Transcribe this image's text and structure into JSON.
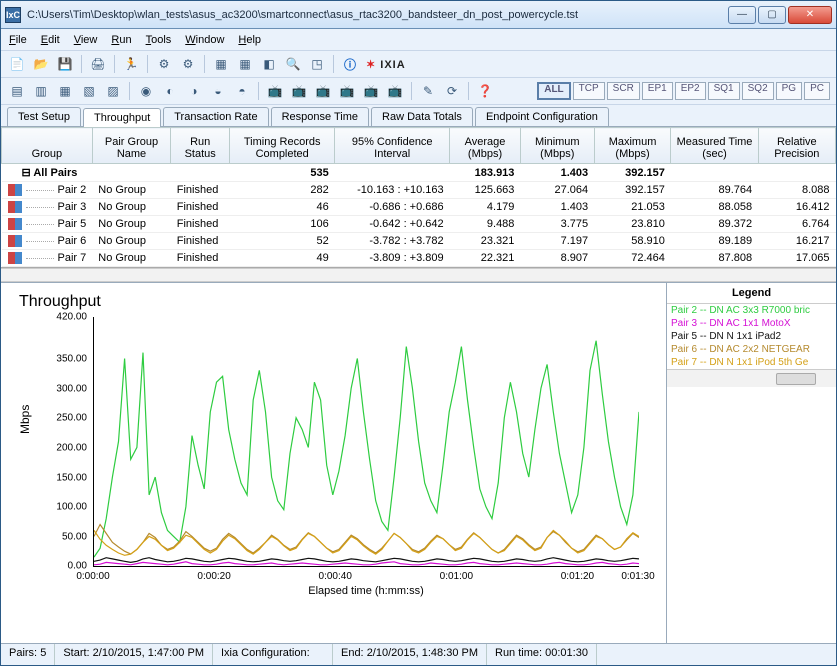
{
  "window": {
    "title": "C:\\Users\\Tim\\Desktop\\wlan_tests\\asus_ac3200\\smartconnect\\asus_rtac3200_bandsteer_dn_post_powercycle.tst",
    "app_icon_text": "IxC"
  },
  "menu": {
    "file": "File",
    "edit": "Edit",
    "view": "View",
    "run": "Run",
    "tools": "Tools",
    "window": "Window",
    "help": "Help"
  },
  "brand": "IXIA",
  "filters": [
    "ALL",
    "TCP",
    "SCR",
    "EP1",
    "EP2",
    "SQ1",
    "SQ2",
    "PG",
    "PC"
  ],
  "tabs": [
    "Test Setup",
    "Throughput",
    "Transaction Rate",
    "Response Time",
    "Raw Data Totals",
    "Endpoint Configuration"
  ],
  "active_tab": "Throughput",
  "grid": {
    "headers": [
      "Group",
      "Pair Group Name",
      "Run Status",
      "Timing Records Completed",
      "95% Confidence Interval",
      "Average (Mbps)",
      "Minimum (Mbps)",
      "Maximum (Mbps)",
      "Measured Time (sec)",
      "Relative Precision"
    ],
    "allpairs": {
      "label": "All Pairs",
      "trc": "535",
      "avg": "183.913",
      "min": "1.403",
      "max": "392.157"
    },
    "rows": [
      {
        "name": "Pair 2",
        "pg": "No Group",
        "rs": "Finished",
        "trc": "282",
        "ci": "-10.163 : +10.163",
        "avg": "125.663",
        "min": "27.064",
        "max": "392.157",
        "mt": "89.764",
        "rp": "8.088"
      },
      {
        "name": "Pair 3",
        "pg": "No Group",
        "rs": "Finished",
        "trc": "46",
        "ci": "-0.686 : +0.686",
        "avg": "4.179",
        "min": "1.403",
        "max": "21.053",
        "mt": "88.058",
        "rp": "16.412"
      },
      {
        "name": "Pair 5",
        "pg": "No Group",
        "rs": "Finished",
        "trc": "106",
        "ci": "-0.642 : +0.642",
        "avg": "9.488",
        "min": "3.775",
        "max": "23.810",
        "mt": "89.372",
        "rp": "6.764"
      },
      {
        "name": "Pair 6",
        "pg": "No Group",
        "rs": "Finished",
        "trc": "52",
        "ci": "-3.782 : +3.782",
        "avg": "23.321",
        "min": "7.197",
        "max": "58.910",
        "mt": "89.189",
        "rp": "16.217"
      },
      {
        "name": "Pair 7",
        "pg": "No Group",
        "rs": "Finished",
        "trc": "49",
        "ci": "-3.809 : +3.809",
        "avg": "22.321",
        "min": "8.907",
        "max": "72.464",
        "mt": "87.808",
        "rp": "17.065"
      }
    ]
  },
  "chart_title": "Throughput",
  "legend_title": "Legend",
  "legend": [
    {
      "label": "Pair 2 -- DN  AC 3x3 R7000 bric",
      "color": "#2ecc40"
    },
    {
      "label": "Pair 3 -- DN AC 1x1 MotoX",
      "color": "#d40fd4"
    },
    {
      "label": "Pair 5 -- DN N 1x1 iPad2",
      "color": "#111111"
    },
    {
      "label": "Pair 6 -- DN  AC 2x2 NETGEAR",
      "color": "#b58a2e"
    },
    {
      "label": "Pair 7 -- DN  N 1x1 iPod 5th Ge",
      "color": "#d4a017"
    }
  ],
  "status": {
    "pairs_l": "Pairs:",
    "pairs_v": "5",
    "start_l": "Start:",
    "start_v": "2/10/2015, 1:47:00 PM",
    "cfg_l": "Ixia Configuration:",
    "end_l": "End:",
    "end_v": "2/10/2015, 1:48:30 PM",
    "rt_l": "Run time:",
    "rt_v": "00:01:30"
  },
  "chart_data": {
    "type": "line",
    "xlabel": "Elapsed time (h:mm:ss)",
    "ylabel": "Mbps",
    "ylim": [
      0,
      420
    ],
    "yticks": [
      0,
      50,
      100,
      150,
      200,
      250,
      300,
      350,
      420
    ],
    "yticklabels": [
      "0.00",
      "50.00",
      "100.00",
      "150.00",
      "200.00",
      "250.00",
      "300.00",
      "350.00",
      "420.00"
    ],
    "xlim": [
      0,
      90
    ],
    "xticks": [
      0,
      20,
      40,
      60,
      80,
      90
    ],
    "xticklabels": [
      "0:00:00",
      "0:00:20",
      "0:00:40",
      "0:01:00",
      "0:01:20",
      "0:01:30"
    ],
    "series": [
      {
        "name": "Pair 2",
        "color": "#2ecc40",
        "values": [
          15,
          30,
          80,
          150,
          210,
          350,
          180,
          200,
          360,
          120,
          150,
          90,
          60,
          50,
          40,
          100,
          220,
          170,
          130,
          260,
          310,
          320,
          230,
          180,
          140,
          120,
          280,
          330,
          260,
          150,
          110,
          95,
          190,
          250,
          230,
          200,
          310,
          280,
          170,
          120,
          160,
          220,
          300,
          350,
          260,
          180,
          110,
          75,
          60,
          150,
          250,
          370,
          300,
          210,
          140,
          110,
          90,
          170,
          260,
          310,
          370,
          280,
          200,
          130,
          100,
          80,
          140,
          250,
          310,
          260,
          190,
          150,
          230,
          300,
          340,
          260,
          190,
          140,
          90,
          120,
          200,
          330,
          380,
          290,
          210,
          150,
          100,
          70,
          120,
          260
        ]
      },
      {
        "name": "Pair 3",
        "color": "#d40fd4",
        "values": [
          2,
          3,
          6,
          5,
          4,
          3,
          2,
          4,
          6,
          5,
          4,
          3,
          2,
          3,
          5,
          7,
          4,
          3,
          2,
          2,
          3,
          5,
          6,
          4,
          3,
          2,
          2,
          3,
          4,
          5,
          3,
          2,
          3,
          4,
          5,
          4,
          3,
          2,
          2,
          3,
          4,
          5,
          4,
          3,
          2,
          2,
          3,
          5,
          6,
          7,
          4,
          3,
          2,
          2,
          3,
          5,
          4,
          3,
          2,
          2,
          3,
          5,
          6,
          4,
          3,
          2,
          2,
          3,
          4,
          5,
          4,
          3,
          2,
          2,
          3,
          5,
          6,
          4,
          3,
          2,
          2,
          3,
          5,
          6,
          4,
          3,
          2,
          3,
          5,
          4
        ]
      },
      {
        "name": "Pair 5",
        "color": "#111111",
        "values": [
          8,
          10,
          14,
          12,
          10,
          8,
          6,
          8,
          12,
          14,
          11,
          9,
          7,
          8,
          10,
          13,
          12,
          10,
          8,
          7,
          9,
          11,
          13,
          12,
          10,
          8,
          7,
          8,
          10,
          12,
          11,
          9,
          8,
          9,
          11,
          13,
          12,
          10,
          8,
          7,
          8,
          10,
          12,
          11,
          9,
          8,
          7,
          9,
          11,
          13,
          12,
          10,
          8,
          7,
          8,
          10,
          12,
          11,
          9,
          8,
          9,
          11,
          13,
          12,
          10,
          8,
          7,
          8,
          10,
          12,
          11,
          9,
          8,
          9,
          12,
          14,
          12,
          10,
          8,
          7,
          8,
          10,
          12,
          11,
          9,
          8,
          9,
          11,
          13,
          12
        ]
      },
      {
        "name": "Pair 6",
        "color": "#b58a2e",
        "values": [
          50,
          70,
          55,
          40,
          32,
          25,
          20,
          28,
          40,
          55,
          48,
          35,
          28,
          32,
          42,
          58,
          50,
          40,
          30,
          25,
          30,
          45,
          55,
          48,
          38,
          28,
          22,
          30,
          40,
          52,
          45,
          35,
          28,
          32,
          45,
          56,
          50,
          40,
          30,
          24,
          28,
          40,
          52,
          46,
          36,
          28,
          22,
          30,
          42,
          55,
          48,
          38,
          28,
          24,
          30,
          42,
          52,
          46,
          36,
          28,
          32,
          45,
          56,
          48,
          38,
          28,
          22,
          28,
          40,
          52,
          46,
          36,
          28,
          32,
          48,
          58,
          52,
          40,
          30,
          24,
          28,
          40,
          52,
          46,
          36,
          28,
          32,
          44,
          55,
          48
        ]
      },
      {
        "name": "Pair 7",
        "color": "#d4a017",
        "values": [
          60,
          45,
          35,
          28,
          22,
          18,
          20,
          28,
          40,
          50,
          45,
          35,
          26,
          30,
          40,
          52,
          48,
          38,
          28,
          22,
          28,
          42,
          52,
          46,
          36,
          26,
          20,
          28,
          40,
          50,
          44,
          34,
          26,
          30,
          44,
          55,
          50,
          40,
          30,
          22,
          26,
          38,
          50,
          44,
          34,
          26,
          20,
          28,
          42,
          55,
          48,
          38,
          26,
          22,
          28,
          40,
          50,
          46,
          36,
          26,
          30,
          44,
          55,
          48,
          38,
          28,
          22,
          26,
          38,
          50,
          44,
          34,
          26,
          30,
          48,
          60,
          52,
          42,
          30,
          22,
          26,
          38,
          50,
          46,
          36,
          28,
          32,
          46,
          56,
          50
        ]
      }
    ]
  }
}
